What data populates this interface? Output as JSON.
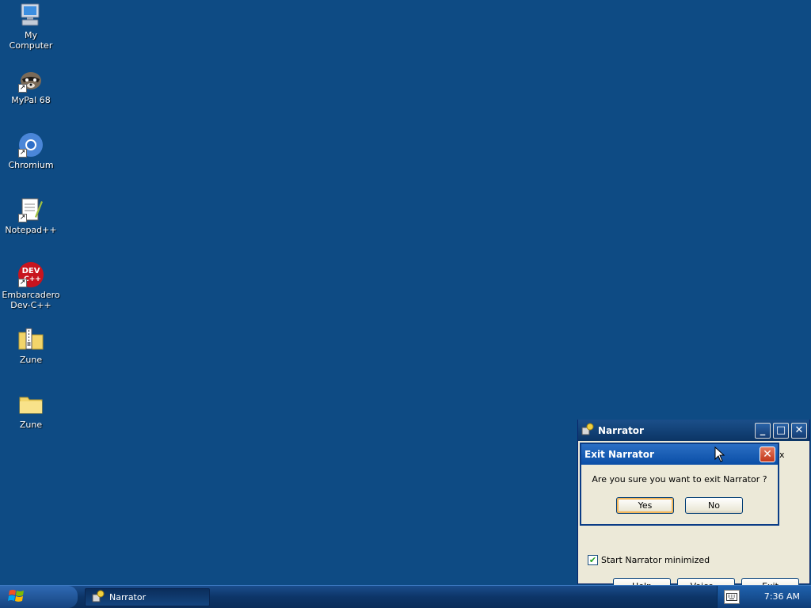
{
  "desktop": {
    "icons": [
      {
        "label": "My Computer",
        "icon": "computer-icon"
      },
      {
        "label": "MyPal 68",
        "icon": "raccoon-icon"
      },
      {
        "label": "Chromium",
        "icon": "chromium-icon"
      },
      {
        "label": "Notepad++",
        "icon": "notepad-plus-plus-icon"
      },
      {
        "label": "Embarcadero Dev-C++",
        "icon": "dev-cpp-icon",
        "badge_line1": "DEV",
        "badge_line2": "C++"
      },
      {
        "label": "Zune",
        "icon": "zipped-folder-icon"
      },
      {
        "label": "Zune",
        "icon": "folder-icon"
      }
    ]
  },
  "narrator": {
    "title": "Narrator",
    "checkbox_label": "Start Narrator minimized",
    "checkbox_checked": true,
    "buttons": {
      "help": "Help",
      "voice": "Voice...",
      "exit": "Exit"
    },
    "partial_text": "x"
  },
  "exit_dialog": {
    "title": "Exit Narrator",
    "message": "Are you sure you want to exit Narrator ?",
    "yes": "Yes",
    "no": "No"
  },
  "taskbar": {
    "task_label": "Narrator",
    "clock": "7:36 AM"
  },
  "colors": {
    "desktop": "#0e4b84",
    "taskbar": "#0d3568",
    "dialog_face": "#ece9d8"
  }
}
